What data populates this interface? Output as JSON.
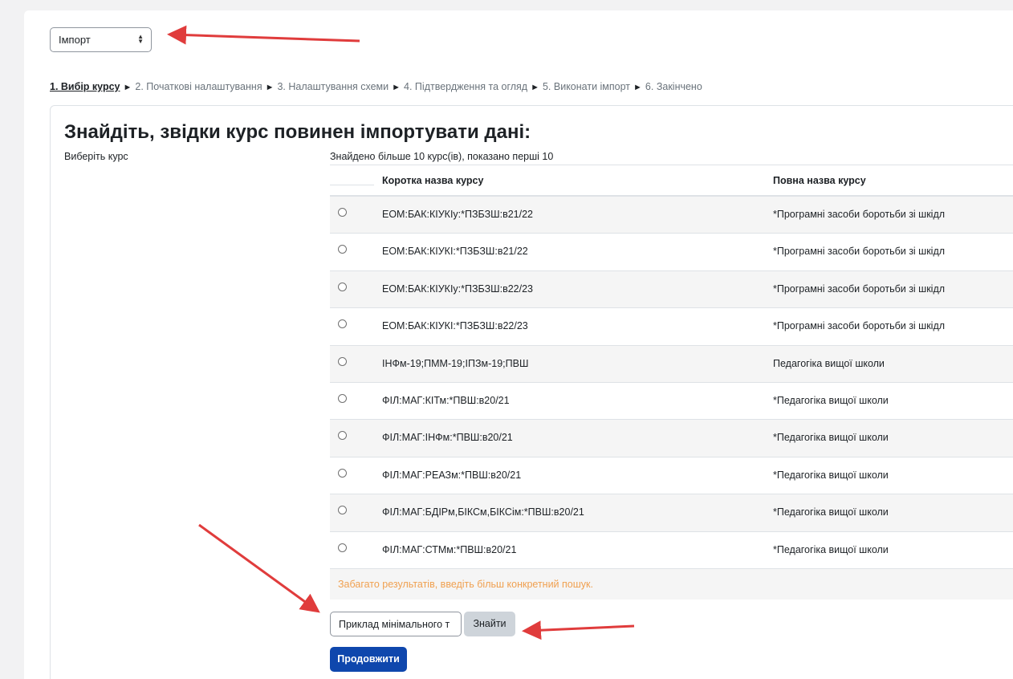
{
  "import_select": {
    "value": "Імпорт"
  },
  "steps": [
    {
      "label": "1. Вибір курсу",
      "current": true
    },
    {
      "label": "2. Початкові налаштування"
    },
    {
      "label": "3. Налаштування схеми"
    },
    {
      "label": "4. Підтвердження та огляд"
    },
    {
      "label": "5. Виконати імпорт"
    },
    {
      "label": "6. Закінчено"
    }
  ],
  "step_separator": "►",
  "card": {
    "title": "Знайдіть, звідки курс повинен імпортувати дані:",
    "select_label": "Виберіть курс",
    "found_text": "Знайдено більше 10 курс(ів), показано перші 10"
  },
  "table": {
    "headers": [
      "Коротка назва курсу",
      "Повна назва курсу"
    ],
    "rows": [
      [
        "ЕОМ:БАК:КІУКІу:*ПЗБЗШ:в21/22",
        "*Програмні засоби боротьби зі шкідл"
      ],
      [
        "ЕОМ:БАК:КІУКІ:*ПЗБЗШ:в21/22",
        "*Програмні засоби боротьби зі шкідл"
      ],
      [
        "ЕОМ:БАК:КІУКІу:*ПЗБЗШ:в22/23",
        "*Програмні засоби боротьби зі шкідл"
      ],
      [
        "ЕОМ:БАК:КІУКІ:*ПЗБЗШ:в22/23",
        "*Програмні засоби боротьби зі шкідл"
      ],
      [
        "ІНФм-19;ПММ-19;ІПЗм-19;ПВШ",
        "Педагогіка вищої школи"
      ],
      [
        "ФІЛ:МАГ:КІТм:*ПВШ:в20/21",
        "*Педагогіка вищої школи"
      ],
      [
        "ФІЛ:МАГ:ІНФм:*ПВШ:в20/21",
        "*Педагогіка вищої школи"
      ],
      [
        "ФІЛ:МАГ:РЕАЗм:*ПВШ:в20/21",
        "*Педагогіка вищої школи"
      ],
      [
        "ФІЛ:МАГ:БДІРм,БІКСм,БІКСім:*ПВШ:в20/21",
        "*Педагогіка вищої школи"
      ],
      [
        "ФІЛ:МАГ:СТМм:*ПВШ:в20/21",
        "*Педагогіка вищої школи"
      ]
    ],
    "too_many_message": "Забагато результатів, введіть більш конкретний пошук."
  },
  "search": {
    "placeholder": "Приклад мінімального т",
    "button_label": "Знайти"
  },
  "continue_button": "Продовжити",
  "colors": {
    "primary": "#0f47ad",
    "warning": "#f0a050",
    "annotation_arrow": "#e03c3c"
  }
}
